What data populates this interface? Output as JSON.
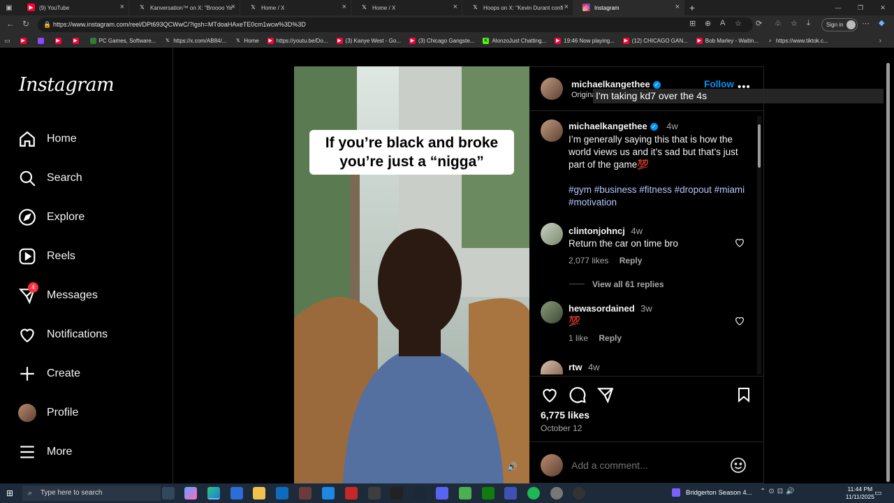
{
  "browser": {
    "tabs": [
      {
        "title": "(9) YouTube",
        "icon": "youtube-icon",
        "color": "#ff0033"
      },
      {
        "title": "Kanversation™ on X: \"Broooo Ye",
        "icon": "x-icon",
        "color": "#000000"
      },
      {
        "title": "Home / X",
        "icon": "x-icon",
        "color": "#000000"
      },
      {
        "title": "Home / X",
        "icon": "x-icon",
        "color": "#000000"
      },
      {
        "title": "Hoops on X: \"Kevin Durant confi",
        "icon": "x-icon",
        "color": "#000000"
      },
      {
        "title": "Instagram",
        "icon": "instagram-icon",
        "color": "#d62976"
      }
    ],
    "url": "https://www.instagram.com/reel/DPt693QCWwC/?igsh=MTdoaHAxeTE0cm1wcw%3D%3D",
    "sign_in": "Sign in",
    "bookmarks": [
      {
        "label": "",
        "color": "#ff0033"
      },
      {
        "label": "",
        "color": "#9146ff"
      },
      {
        "label": "",
        "color": "#ff0033"
      },
      {
        "label": "",
        "color": "#ff0033"
      },
      {
        "label": "PC Games, Software...",
        "color": "#2e7d32"
      },
      {
        "label": "https://x.com/AB84/...",
        "color": "#000000"
      },
      {
        "label": "Home",
        "color": "#000000"
      },
      {
        "label": "https://youtu.be/Do...",
        "color": "#ff0033"
      },
      {
        "label": "(3) Kanye West - Go...",
        "color": "#ff0033"
      },
      {
        "label": "(3) Chicago Gangste...",
        "color": "#ff0033"
      },
      {
        "label": "AlonzoJust Chatting...",
        "color": "#53fc18"
      },
      {
        "label": "19:46 Now playing...",
        "color": "#ff0033"
      },
      {
        "label": "(12) CHICAGO GAN...",
        "color": "#ff0033"
      },
      {
        "label": "Bob Marley - Waitin...",
        "color": "#ff0033"
      },
      {
        "label": "https://www.tiktok.c...",
        "color": "#000000"
      }
    ]
  },
  "sidebar": {
    "logo": "Instagram",
    "items": [
      {
        "label": "Home",
        "icon": "home-icon"
      },
      {
        "label": "Search",
        "icon": "search-icon"
      },
      {
        "label": "Explore",
        "icon": "compass-icon"
      },
      {
        "label": "Reels",
        "icon": "reels-icon"
      },
      {
        "label": "Messages",
        "icon": "messenger-icon",
        "badge": "4"
      },
      {
        "label": "Notifications",
        "icon": "heart-icon"
      },
      {
        "label": "Create",
        "icon": "plus-icon"
      },
      {
        "label": "Profile",
        "icon": "avatar-icon"
      },
      {
        "label": "More",
        "icon": "menu-icon"
      }
    ]
  },
  "video": {
    "overlay_text_line1": "If you’re black and broke",
    "overlay_text_line2": "you’re just a “nigga”"
  },
  "post": {
    "header": {
      "username": "michaelkangethee",
      "subtitle": "Original audio",
      "follow": "Follow",
      "more": "..."
    },
    "tooltip": "I'm taking kd7 over the 4s",
    "caption": {
      "username": "michaelkangethee",
      "time": "4w",
      "text": "I’m generally saying this that is how the world views us and it’s sad but that’s just part of the game💯",
      "hashtags": "#gym #business #fitness #dropout #miami #motivation"
    },
    "comments": [
      {
        "username": "clintonjohncj",
        "time": "4w",
        "text": "Return the car on time bro",
        "likes": "2,077 likes",
        "reply": "Reply",
        "view_replies": "View all 61 replies"
      },
      {
        "username": "hewasordained",
        "time": "3w",
        "text": "💯",
        "likes": "1 like",
        "reply": "Reply"
      },
      {
        "username": "rtw",
        "time": "4w"
      }
    ],
    "likes": "6,775 likes",
    "date": "October 12",
    "add_comment_placeholder": "Add a comment..."
  },
  "taskbar": {
    "search_placeholder": "Type here to search",
    "media": "Bridgerton Season 4...",
    "time": "11:44 PM",
    "date": "11/11/2025"
  },
  "colors": {
    "accent_blue": "#0095f6",
    "follow_blue": "#0095f6",
    "badge_red": "#ff3040"
  }
}
